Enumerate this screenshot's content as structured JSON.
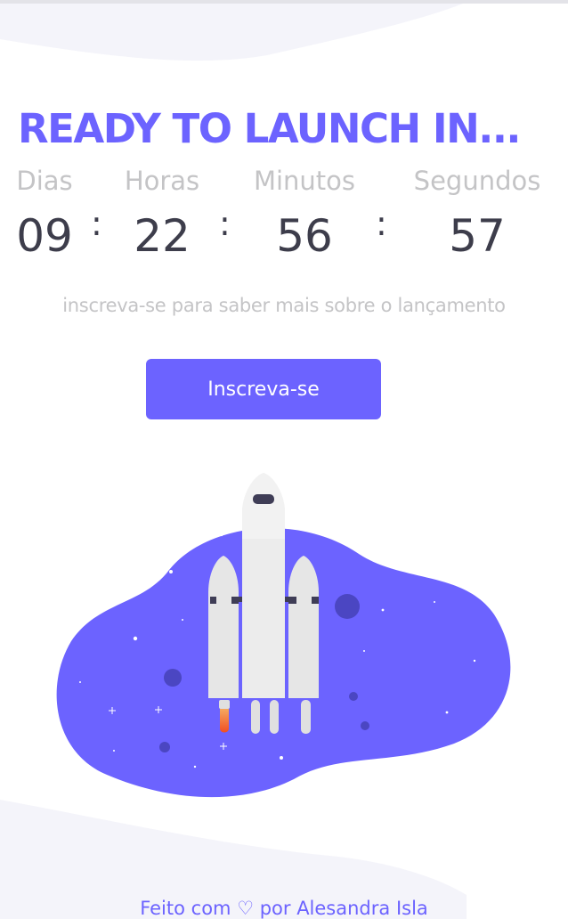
{
  "hero": {
    "title": "READY TO LAUNCH IN..."
  },
  "countdown": {
    "units": [
      {
        "label": "Dias",
        "value": "09"
      },
      {
        "label": "Horas",
        "value": "22"
      },
      {
        "label": "Minutos",
        "value": "56"
      },
      {
        "label": "Segundos",
        "value": "57"
      }
    ],
    "separator": ":"
  },
  "subtitle": "inscreva-se para saber mais sobre o lançamento",
  "cta": {
    "label": "Inscreva-se"
  },
  "footer": {
    "prefix": "Feito com",
    "heart": "♡",
    "suffix": "por Alesandra Isla"
  },
  "colors": {
    "accent": "#6c63ff",
    "text_dark": "#3d3d4b",
    "text_muted": "#c4c4c6",
    "wave": "#f4f4fa"
  }
}
